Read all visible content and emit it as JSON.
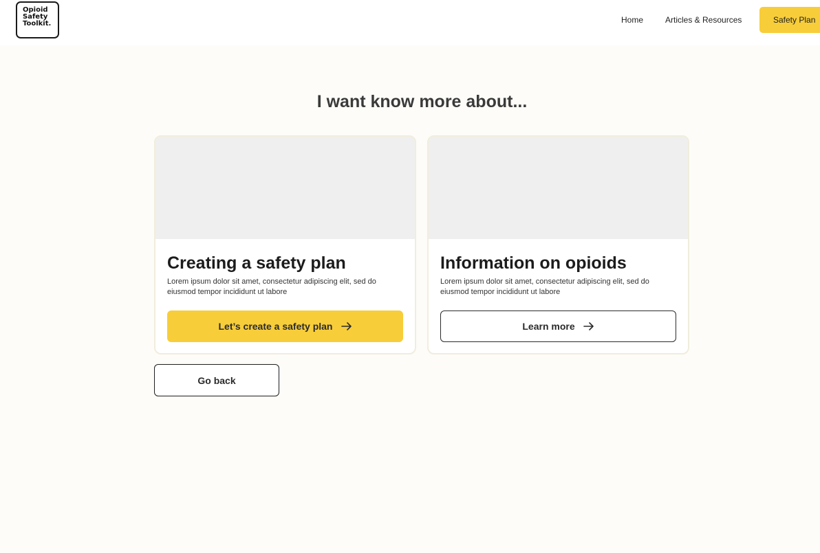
{
  "brand": {
    "logo_lines": [
      "Opioid",
      "Safety",
      "Toolkit."
    ]
  },
  "nav": {
    "home": "Home",
    "articles": "Articles & Resources",
    "cta": "Safety Plan"
  },
  "main": {
    "heading": "I want know more about...",
    "cards": [
      {
        "title": "Creating a safety plan",
        "description": "Lorem ipsum dolor sit amet, consectetur adipiscing elit, sed do eiusmod tempor incididunt ut labore",
        "button_label": "Let’s create a safety plan",
        "button_icon": "arrow-right-icon"
      },
      {
        "title": "Information on opioids",
        "description": "Lorem ipsum dolor sit amet, consectetur adipiscing elit, sed do eiusmod tempor incididunt ut labore",
        "button_label": "Learn more",
        "button_icon": "arrow-right-icon"
      }
    ],
    "back_label": "Go back"
  },
  "colors": {
    "accent": "#f7cd3a",
    "background": "#fdfcf8",
    "card_border": "#f1eddd",
    "image_placeholder": "#efefef"
  }
}
